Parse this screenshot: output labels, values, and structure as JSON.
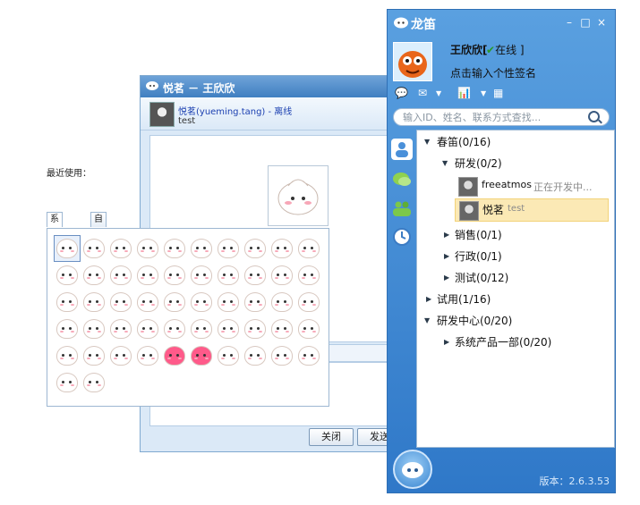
{
  "chat_window": {
    "title": "悦茗 － 王欣欣",
    "contact_name": "悦茗(yueming.tang) - 离线",
    "contact_signature": "test",
    "buttons": {
      "close": "关闭",
      "send": "发送"
    }
  },
  "emoticons": {
    "recent_label": "最近使用：",
    "tabs": [
      "系统表情",
      "自定义表情"
    ],
    "count": 52
  },
  "main_panel": {
    "title": "龙笛",
    "user_name": "王欣欣[",
    "user_status": "在线 ]",
    "signature_prompt": "点击输入个性签名",
    "search_placeholder": "输入ID、姓名、联系方式查找...",
    "tree": {
      "root": "春笛(0/16)",
      "group_dev": "研发(0/2)",
      "contact1_name": "freeatmos",
      "contact1_status": "正在开发中...",
      "contact2_name": "悦茗",
      "contact2_status": "test",
      "group_sales": "销售(0/1)",
      "group_admin": "行政(0/1)",
      "group_test": "测试(0/12)",
      "trial": "试用(1/16)",
      "rd_center": "研发中心(0/20)",
      "sys_dept": "系统产品一部(0/20)"
    },
    "version": "版本：2.6.3.53"
  },
  "colors": {
    "accent": "#3f7fc1",
    "selected_row": "#fbe9b5"
  }
}
